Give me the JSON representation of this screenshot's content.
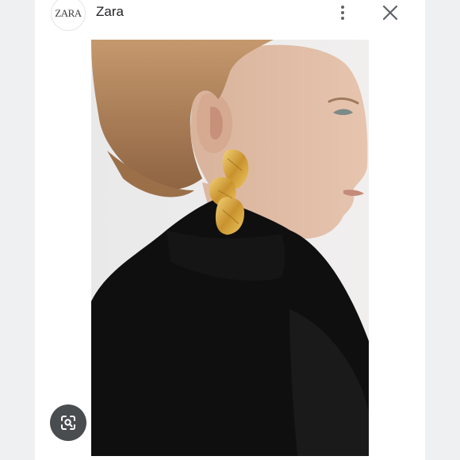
{
  "header": {
    "logo_text": "ZARA",
    "site_name": "Zara",
    "more_icon": "more-vert-icon",
    "close_icon": "close-icon"
  },
  "image": {
    "subject": "photo",
    "overlay_icon": "lens-icon"
  },
  "colors": {
    "background": "#eef0f2",
    "sheet": "#ffffff",
    "lens_button": "#4a4d50",
    "icon": "#5f6368"
  }
}
